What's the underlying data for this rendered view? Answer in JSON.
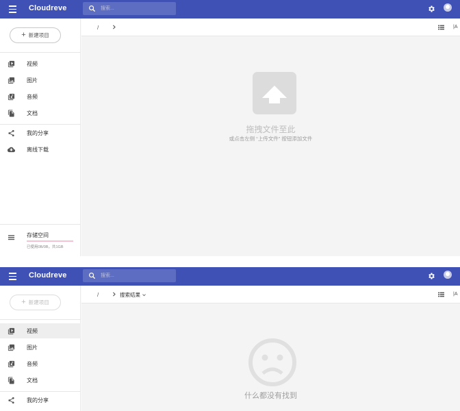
{
  "app": {
    "brand": "Cloudreve",
    "search_placeholder": "搜索..."
  },
  "sidebar": {
    "new_button": "新建项目",
    "items": [
      {
        "label": "视频",
        "icon": "video-icon"
      },
      {
        "label": "图片",
        "icon": "image-icon"
      },
      {
        "label": "音频",
        "icon": "audio-icon"
      },
      {
        "label": "文档",
        "icon": "document-icon"
      }
    ],
    "share": {
      "label": "我的分享",
      "icon": "share-icon"
    },
    "download": {
      "label": "离线下载",
      "icon": "cloud-download-icon"
    },
    "storage": {
      "title": "存储空间",
      "usage": "已使用0B/0B，共1GB",
      "used_fraction": 0.0
    }
  },
  "view1": {
    "toolbar": {
      "root": "/",
      "sort_label": "|A"
    },
    "empty_title": "拖拽文件至此",
    "empty_sub": "或点击左侧 “上传文件” 按钮添加文件"
  },
  "view2": {
    "toolbar": {
      "root": "/",
      "crumb": "搜索结果",
      "sort_label": "|A"
    },
    "active_item": "视频",
    "nothing_found": "什么都没有找到"
  },
  "colors": {
    "appbar": "#3f51b5",
    "accent": "#e91e63"
  }
}
